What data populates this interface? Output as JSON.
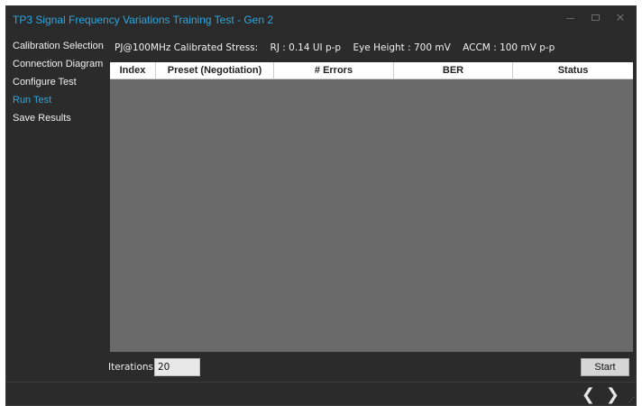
{
  "window": {
    "title": "TP3 Signal Frequency Variations Training Test - Gen 2",
    "controls": {
      "minimize": "minimize-icon",
      "maximize": "maximize-icon",
      "close": "close-icon"
    }
  },
  "sidebar": {
    "items": [
      {
        "label": "Calibration Selection",
        "active": false
      },
      {
        "label": "Connection Diagram",
        "active": false
      },
      {
        "label": "Configure Test",
        "active": false
      },
      {
        "label": "Run Test",
        "active": true
      },
      {
        "label": "Save Results",
        "active": false
      }
    ]
  },
  "stress_info": {
    "pj": "PJ@100MHz Calibrated Stress:",
    "rj": "RJ : 0.14 UI p-p",
    "eye_height": "Eye Height : 700 mV",
    "accm": "ACCM : 100 mV p-p"
  },
  "results_table": {
    "columns": [
      "Index",
      "Preset (Negotiation)",
      "# Errors",
      "BER",
      "Status"
    ],
    "rows": []
  },
  "iterations": {
    "label": "Iterations",
    "value": "20"
  },
  "actions": {
    "start_label": "Start"
  },
  "footer": {
    "prev_icon": "chevron-left-icon",
    "next_icon": "chevron-right-icon"
  },
  "colors": {
    "accent": "#2aa8e0",
    "background": "#2b2b2b",
    "table_body": "#6a6a6a"
  }
}
